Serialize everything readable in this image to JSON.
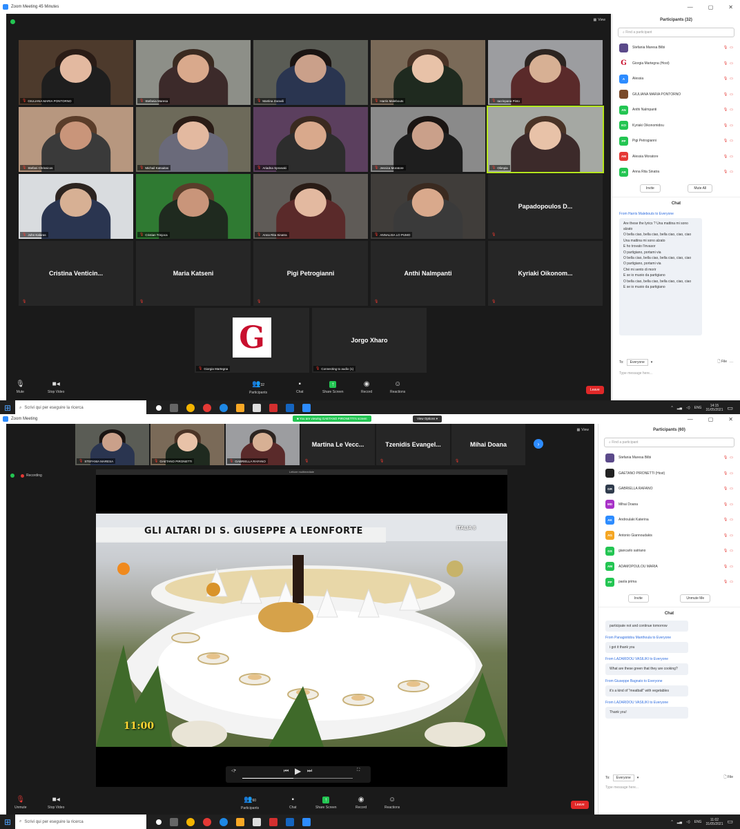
{
  "shot1": {
    "window_title": "Zoom Meeting 45 Minutes",
    "view_label": "View",
    "participants_title": "Participants (32)",
    "search_placeholder": "Find a participant",
    "participants": [
      {
        "name": "Stefania Maresa Bilbi",
        "initials": "",
        "color": "#5b4a8a"
      },
      {
        "name": "Giorgia Martegna (Host)",
        "initials": "G",
        "color": "#ffffff"
      },
      {
        "name": "Alessia",
        "initials": "A",
        "color": "#2d8cff"
      },
      {
        "name": "GIULIANA MARIA PONTORNO",
        "initials": "",
        "color": "#7a4a2a"
      },
      {
        "name": "Anthi Nalmpanti",
        "initials": "AN",
        "color": "#23c552"
      },
      {
        "name": "Kyriaki Oikonomidou",
        "initials": "KO",
        "color": "#23c552"
      },
      {
        "name": "Pigi Petrogianni",
        "initials": "PP",
        "color": "#23c552"
      },
      {
        "name": "Alessia Moratore",
        "initials": "AM",
        "color": "#e53935"
      },
      {
        "name": "Anna Rita Sinatra",
        "initials": "AR",
        "color": "#23c552"
      }
    ],
    "invite_label": "Invite",
    "mute_all_label": "Mute All",
    "chat_title": "Chat",
    "chat_from": "From Harris Malebouts to Everyone",
    "chat_message": "Are these the lyrics ? Una mattina mi sono alzato\nO bella ciao, bella ciao, bella ciao, ciao, ciao\nUna mattina mi sono alzato\nE ho trovato l'invasor\nO partigiano, portami via\nO bella ciao, bella ciao, bella ciao, ciao, ciao\nO partigiano, portami via\nChé mi sento di morir\nE se io muoio da partigiano\nO bella ciao, bella ciao, bella ciao, ciao, ciao\nE se io muoio da partigiano",
    "chat_to_label": "To:",
    "chat_to_value": "Everyone",
    "file_label": "File",
    "chat_placeholder": "Type message here...",
    "tiles": [
      {
        "label": "GIULIANA MARIA PONTORNO",
        "big": ""
      },
      {
        "label": "Stefania Maresa",
        "big": ""
      },
      {
        "label": "Martina Zaravili",
        "big": ""
      },
      {
        "label": "Harris Malebouts",
        "big": ""
      },
      {
        "label": "Iacrinpana Pinto",
        "big": ""
      },
      {
        "label": "Stefani Chrissicos",
        "big": ""
      },
      {
        "label": "Michail Katsaitas",
        "big": ""
      },
      {
        "label": "Ariadna Spranaki",
        "big": ""
      },
      {
        "label": "Jessica Moratore",
        "big": ""
      },
      {
        "label": "Olimpia",
        "big": ""
      },
      {
        "label": "John Kalaras",
        "big": ""
      },
      {
        "label": "Cristian Trinjoca",
        "big": ""
      },
      {
        "label": "Anna Rita Sinatra",
        "big": ""
      },
      {
        "label": "ANNALISA LO PUMO",
        "big": ""
      },
      {
        "label": "",
        "big": "Papadopoulos D..."
      },
      {
        "label": "",
        "big": "Cristina Venticin..."
      },
      {
        "label": "",
        "big": "Maria Katseni"
      },
      {
        "label": "",
        "big": "Pigi Petrogianni"
      },
      {
        "label": "",
        "big": "Anthi Nalmpanti"
      },
      {
        "label": "",
        "big": "Kyriaki Oikonom..."
      },
      {
        "label": "Giorgia Martegna",
        "big": "G"
      },
      {
        "label": "Connecting to audio (1)",
        "big": "Jorgo Xharo"
      }
    ],
    "controls": {
      "mute": "Mute",
      "stop_video": "Stop Video",
      "participants": "Participants",
      "participants_count": "32",
      "chat": "Chat",
      "share_screen": "Share Screen",
      "record": "Record",
      "reactions": "Reactions",
      "leave": "Leave"
    },
    "taskbar_search": "Scrivi qui per eseguire la ricerca",
    "clock_time": "14:15",
    "clock_date": "31/05/2021",
    "lang": "ENG"
  },
  "shot2": {
    "window_title": "Zoom Meeting",
    "view_label": "View",
    "share_banner": "You are viewing GAETANO PIRONETTI's screen",
    "view_options": "View Options",
    "recording": "Recording",
    "top_tiles": [
      {
        "label": "STEFANIA MARESA",
        "big": ""
      },
      {
        "label": "GAETANO PIRONETTI",
        "big": ""
      },
      {
        "label": "GABRIELLA RAFANO",
        "big": ""
      },
      {
        "label": "",
        "big": "Martina Le Vecc..."
      },
      {
        "label": "",
        "big": "Tzenidis Evangel..."
      },
      {
        "label": "",
        "big": "Mihai Doana"
      }
    ],
    "shared_window_title": "Lettore multimediale",
    "video_title": "GLI ALTARI DI S. GIUSEPPE A LEONFORTE",
    "channel_logo": "ITALIA 8",
    "video_time": "11:00",
    "participants_title": "Participants (60)",
    "search_placeholder": "Find a participant",
    "participants": [
      {
        "name": "Stefania Maresa Bilbi",
        "initials": "",
        "color": "#5b4a8a"
      },
      {
        "name": "GAETANO PIRONETTI (Host)",
        "initials": "",
        "color": "#222222"
      },
      {
        "name": "GABRIELLA RAFANO",
        "initials": "GR",
        "color": "#2f3b4c"
      },
      {
        "name": "Mihai Doana",
        "initials": "MD",
        "color": "#a832c8"
      },
      {
        "name": "Androulaki Katerina",
        "initials": "AK",
        "color": "#2d8cff"
      },
      {
        "name": "Antonio Giannoudakis",
        "initials": "AG",
        "color": "#f5a623"
      },
      {
        "name": "giancarlo satriano",
        "initials": "GS",
        "color": "#23c552"
      },
      {
        "name": "ADAMOPOULOU MARIA",
        "initials": "AM",
        "color": "#23c552"
      },
      {
        "name": "paola prima",
        "initials": "PP",
        "color": "#23c552"
      }
    ],
    "invite_label": "Invite",
    "unmute_me_label": "Unmute Me",
    "chat_title": "Chat",
    "chat": [
      {
        "from": "",
        "text": "participate not and continue tomorrow"
      },
      {
        "from": "From Panagiotidou Manthoula to Everyone",
        "text": "i got it thank you"
      },
      {
        "from": "From LAZARIDOU VASILIKI to Everyone",
        "text": "What are these green that they are cooking?"
      },
      {
        "from": "From Giuseppe Bagnato to Everyone",
        "text": "it's a kind of \"meatball\" with vegetables"
      },
      {
        "from": "From LAZARIDOU VASILIKI to Everyone",
        "text": "Thank you!"
      }
    ],
    "chat_to_label": "To:",
    "chat_to_value": "Everyone",
    "file_label": "File",
    "chat_placeholder": "Type message here...",
    "controls": {
      "mute": "Unmute",
      "stop_video": "Stop Video",
      "participants": "Participants",
      "participants_count": "60",
      "chat": "Chat",
      "share_screen": "Share Screen",
      "record": "Record",
      "reactions": "Reactions",
      "leave": "Leave"
    },
    "taskbar_search": "Scrivi qui per eseguire la ricerca",
    "clock_time": "11:02",
    "clock_date": "31/05/2021",
    "lang": "ENG"
  }
}
